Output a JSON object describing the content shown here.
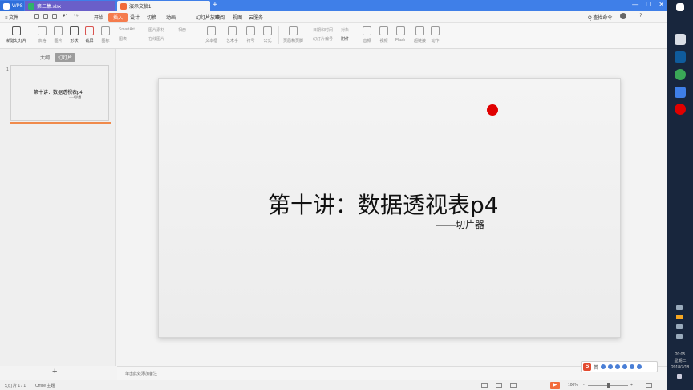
{
  "tabs": {
    "home": "WPS",
    "xlsx": "第二集.xlsx",
    "ppt": "演示文稿1",
    "new": "+"
  },
  "window_controls": [
    "—",
    "☐",
    "✕"
  ],
  "menu": {
    "file": "≡ 文件",
    "items": [
      "开始",
      "插入",
      "设计",
      "切换",
      "动画",
      "幻灯片放映",
      "审阅",
      "视图",
      "云服务"
    ],
    "search": "Q 查找命令",
    "login": "未登录",
    "collab": "协作",
    "share": "分享",
    "help": "?"
  },
  "ribbon": {
    "new_slide": "新建幻灯片",
    "table": "表格",
    "picture": "图片",
    "shapes": "形状",
    "screenshot": "截屏",
    "icons": "图标",
    "chart": "图表",
    "smartart": "SmartArt",
    "text_box": "文本框",
    "art_text": "艺术字",
    "symbol": "符号",
    "formula": "公式",
    "header_footer": "页眉和页脚",
    "slide_number": "幻灯片编号",
    "object": "对象",
    "attach": "附件",
    "audio": "音频",
    "video": "视频",
    "flash": "Flash",
    "hyperlink": "超链接",
    "action": "动作",
    "clip_art": "图片素材",
    "online_image": "在线图片",
    "date_time": "日期和时间",
    "album": "相册"
  },
  "left_panel": {
    "outline_tab": "大纲",
    "slides_tab": "幻灯片",
    "slide_number": "1",
    "thumb_title": "第十讲：数据透视表p4",
    "thumb_sub": "——切片器",
    "add": "+"
  },
  "slide": {
    "title": "第十讲：数据透视表p4",
    "subtitle": "——切片器"
  },
  "notes": {
    "placeholder": "单击此处添加备注"
  },
  "ime": {
    "logo": "S",
    "lang": "英"
  },
  "status": {
    "slide_info": "幻灯片 1 / 1",
    "theme": "Office 主题",
    "zoom": "100%",
    "minus": "-",
    "plus": "+"
  },
  "clock": {
    "time": "20:05",
    "weekday": "星期二",
    "date": "2018/7/18"
  },
  "colors": {
    "title_bar": "#3f7fe8",
    "accent": "#f57c4d",
    "red_dot": "#e00000",
    "taskbar": "#18263d"
  }
}
